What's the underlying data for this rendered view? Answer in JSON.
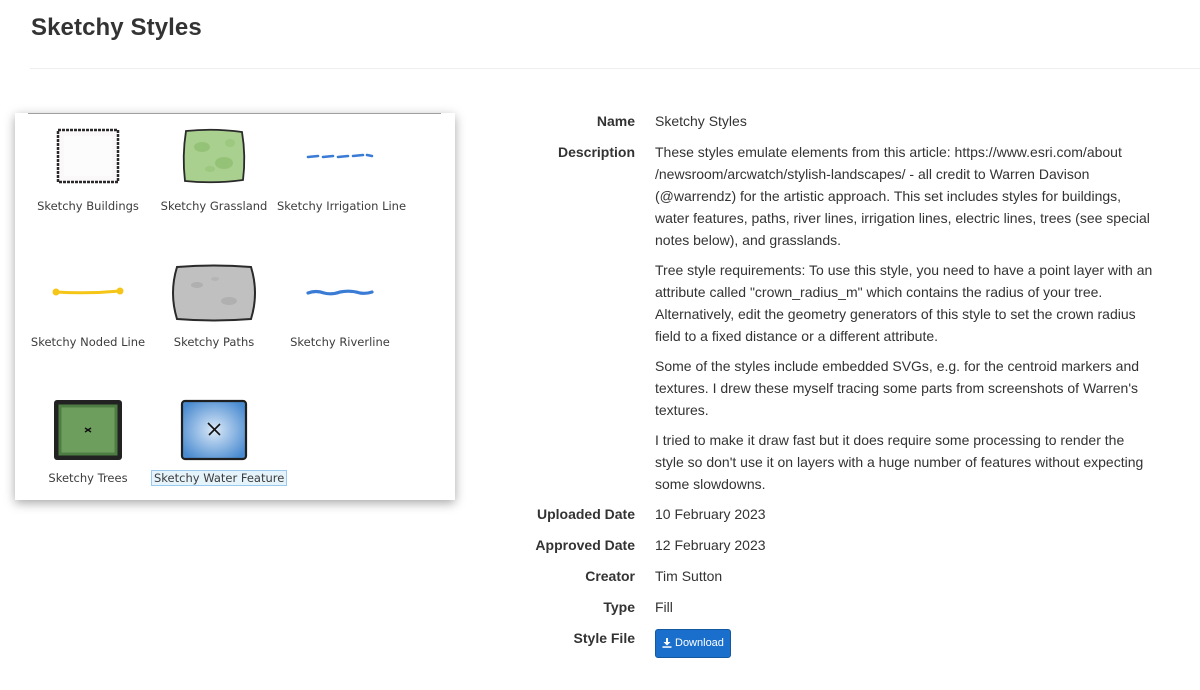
{
  "page": {
    "title": "Sketchy Styles"
  },
  "preview": {
    "items": [
      {
        "label": "Sketchy Buildings",
        "icon": "buildings-swatch-icon"
      },
      {
        "label": "Sketchy Grassland",
        "icon": "grassland-swatch-icon"
      },
      {
        "label": "Sketchy Irrigation Line",
        "icon": "irrigation-line-swatch-icon"
      },
      {
        "label": "Sketchy Noded Line",
        "icon": "noded-line-swatch-icon"
      },
      {
        "label": "Sketchy Paths",
        "icon": "paths-swatch-icon"
      },
      {
        "label": "Sketchy Riverline",
        "icon": "riverline-swatch-icon"
      },
      {
        "label": "Sketchy Trees",
        "icon": "trees-swatch-icon"
      },
      {
        "label": "Sketchy Water Feature",
        "icon": "water-feature-swatch-icon",
        "selected": true
      }
    ]
  },
  "details": {
    "name_label": "Name",
    "name": "Sketchy Styles",
    "description_label": "Description",
    "description": [
      "These styles emulate elements from this article: https://www.esri.com/about /newsroom/arcwatch/stylish-landscapes/ - all credit to Warren Davison (@warrendz) for the artistic approach. This set includes styles for buildings, water features, paths, river lines, irrigation lines, electric lines, trees (see special notes below), and grasslands.",
      "Tree style requirements: To use this style, you need to have a point layer with an attribute called \"crown_radius_m\" which contains the radius of your tree. Alternatively, edit the geometry generators of this style to set the crown radius field to a fixed distance or a different attribute.",
      "Some of the styles include embedded SVGs, e.g. for the centroid markers and textures. I drew these myself tracing some parts from screenshots of Warren's textures.",
      "I tried to make it draw fast but it does require some processing to render the style so don't use it on layers with a huge number of features without expecting some slowdowns."
    ],
    "uploaded_label": "Uploaded Date",
    "uploaded": "10 February 2023",
    "approved_label": "Approved Date",
    "approved": "12 February 2023",
    "creator_label": "Creator",
    "creator": "Tim Sutton",
    "type_label": "Type",
    "type": "Fill",
    "style_file_label": "Style File",
    "download_label": "Download",
    "download_icon": "download-icon"
  },
  "colors": {
    "download_button": "#1b6fcc",
    "grass": "#a9d08e",
    "path": "#c0c0c0",
    "river": "#3a7bd5",
    "noded_line": "#f5c518",
    "trees": "#6e9e5e",
    "water": "#5b9bd5"
  }
}
